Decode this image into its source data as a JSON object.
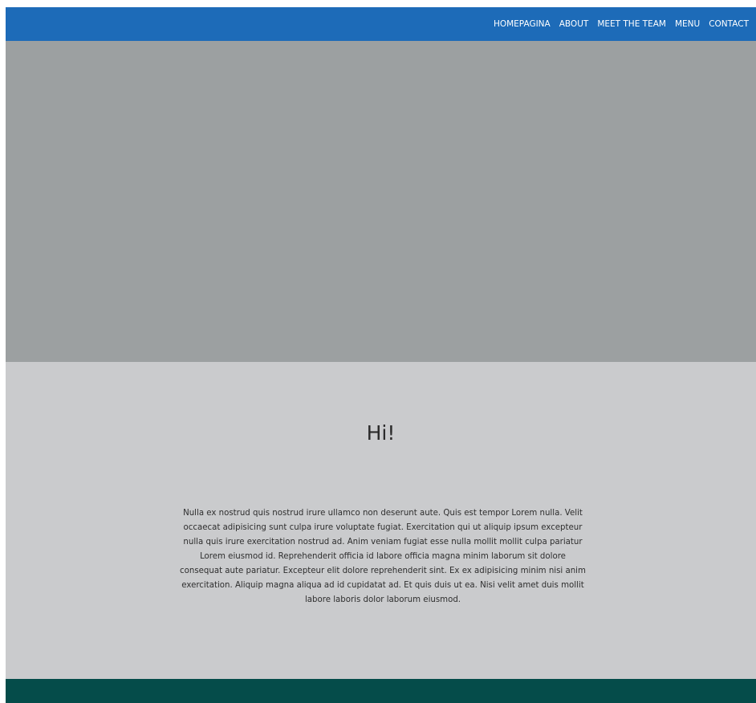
{
  "nav": {
    "items": [
      {
        "label": "HOMEPAGINA"
      },
      {
        "label": "ABOUT"
      },
      {
        "label": "MEET THE TEAM"
      },
      {
        "label": "MENU"
      },
      {
        "label": "CONTACT"
      }
    ]
  },
  "main": {
    "greeting": "Hi!",
    "body": "Nulla ex nostrud quis nostrud irure ullamco non deserunt aute. Quis est tempor Lorem nulla. Velit occaecat adipisicing sunt culpa irure voluptate fugiat. Exercitation qui ut aliquip ipsum excepteur nulla quis irure exercitation nostrud ad. Anim veniam fugiat esse nulla mollit mollit culpa pariatur Lorem eiusmod id. Reprehenderit officia id labore officia magna minim laborum sit dolore consequat aute pariatur. Excepteur elit dolore reprehenderit sint. Ex ex adipisicing minim nisi anim exercitation. Aliquip magna aliqua ad id cupidatat ad. Et quis duis ut ea. Nisi velit amet duis mollit labore laboris dolor laborum eiusmod."
  },
  "colors": {
    "navbar": "#1d6bb8",
    "hero": "#9ca0a1",
    "content": "#cacbcd",
    "footer": "#054c4a"
  }
}
